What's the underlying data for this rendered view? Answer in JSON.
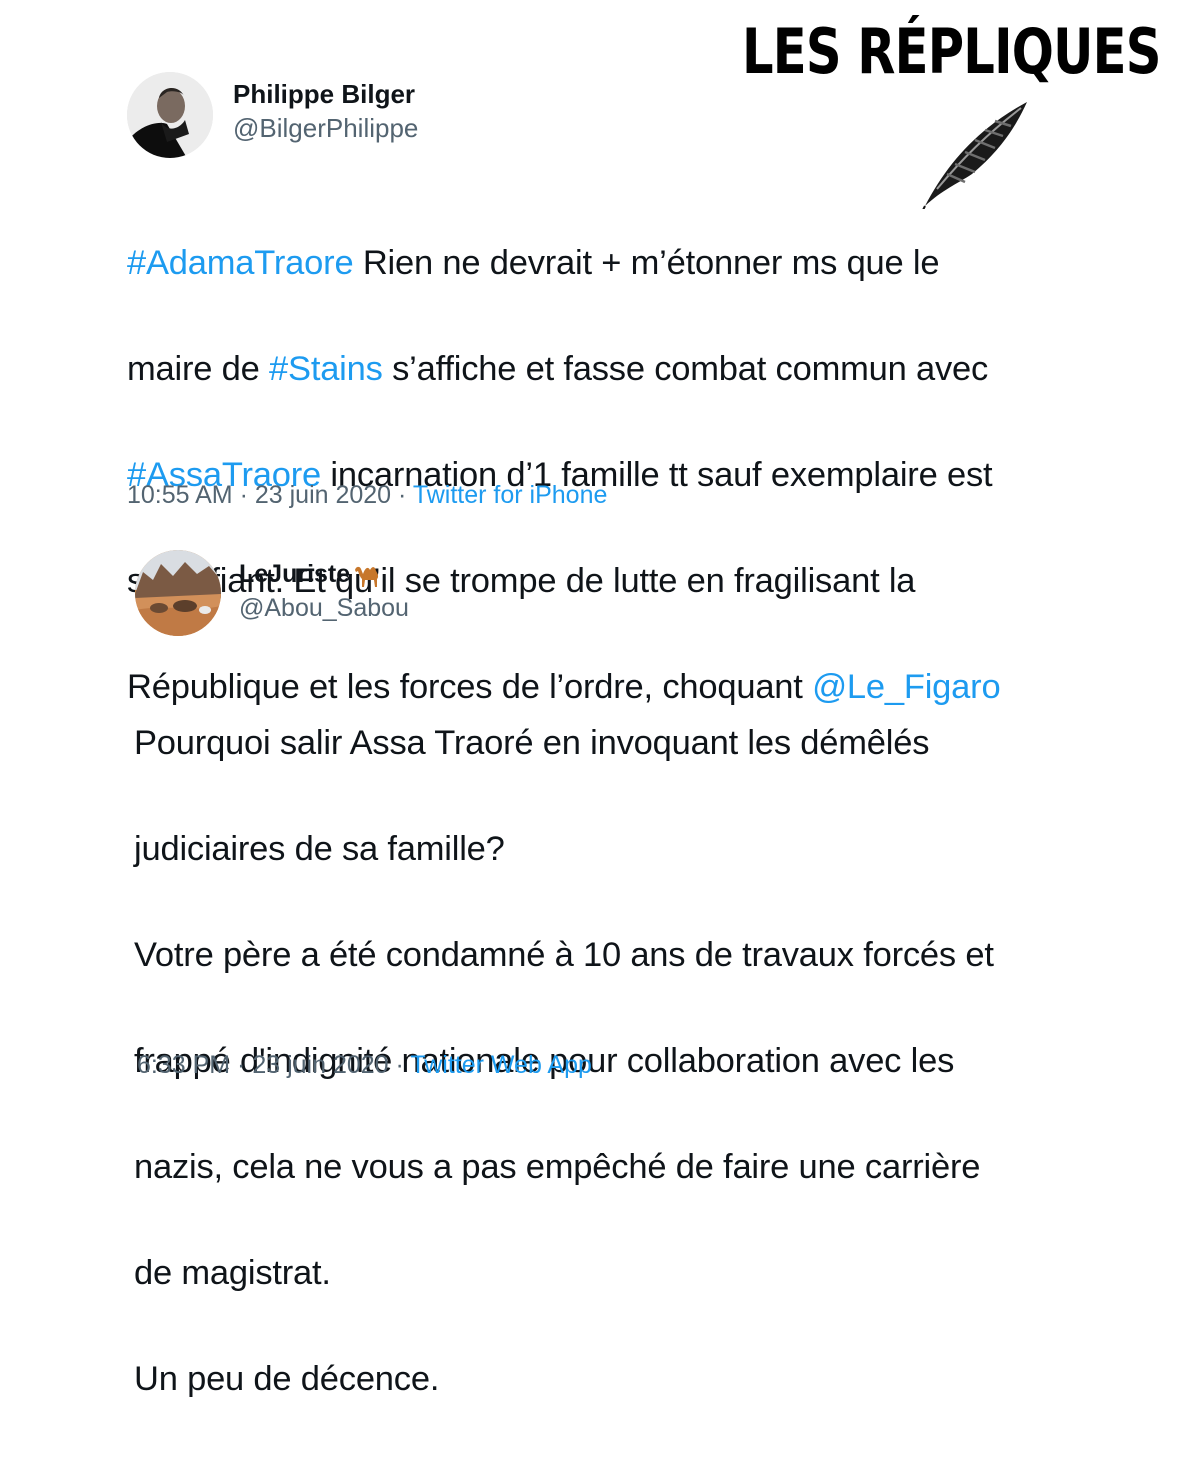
{
  "brand": {
    "title": "LES RÉPLIQUES",
    "icon": "feather-quill-icon"
  },
  "tweets": [
    {
      "author": {
        "name": "Philippe Bilger",
        "handle": "@BilgerPhilippe",
        "avatar_icon": "profile-photo-avatar"
      },
      "text_lines": [
        [
          {
            "text": "#AdamaTraore",
            "link": true
          },
          {
            "text": " Rien ne devrait + m’étonner ms que le",
            "link": false
          }
        ],
        [
          {
            "text": "maire de ",
            "link": false
          },
          {
            "text": "#Stains",
            "link": true
          },
          {
            "text": " s’affiche et fasse combat commun avec",
            "link": false
          }
        ],
        [
          {
            "text": "#AssaTraore",
            "link": true
          },
          {
            "text": " incarnation d’1 famille tt sauf exemplaire est",
            "link": false
          }
        ],
        [
          {
            "text": "stupéfiant. Et qu’il se trompe de lutte en fragilisant la",
            "link": false
          }
        ],
        [
          {
            "text": "République et les forces de l’ordre, choquant ",
            "link": false
          },
          {
            "text": "@Le_Figaro",
            "link": true
          }
        ]
      ],
      "time": "10:55 AM",
      "separator": " · ",
      "date": "23 juin 2020",
      "source": "Twitter for iPhone"
    },
    {
      "author": {
        "name": "LeJuriste",
        "name_emoji": "camel-emoji",
        "handle": "@Abou_Sabou",
        "avatar_icon": "desert-camels-avatar"
      },
      "text_lines": [
        "Pourquoi salir Assa Traoré en invoquant les démêlés",
        "judiciaires de sa famille?",
        "Votre père a été condamné à 10 ans de travaux forcés et",
        "frappé d'indignité nationale pour collaboration avec les",
        "nazis, cela ne vous a pas empêché de faire une carrière",
        "de magistrat.",
        "Un peu de décence."
      ],
      "time": "6:33 PM",
      "separator": " · ",
      "date": "23 juin 2020",
      "source": "Twitter Web App"
    }
  ],
  "colors": {
    "link": "#1d9bf0",
    "text": "#0f1419",
    "muted": "#536471",
    "background": "#ffffff"
  }
}
